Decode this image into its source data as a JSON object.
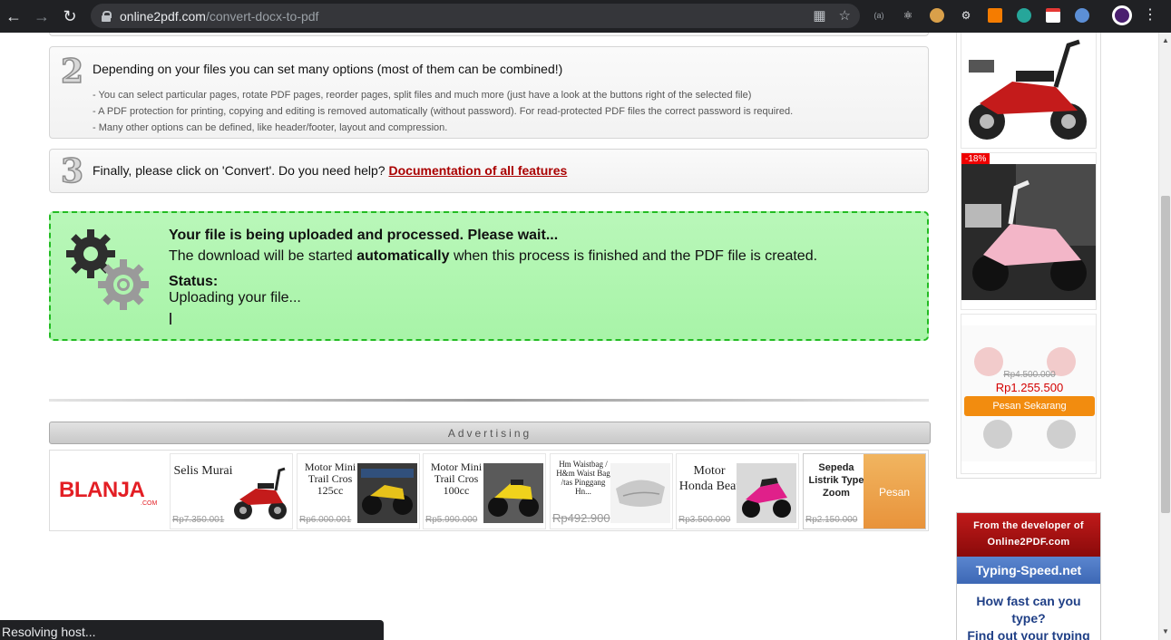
{
  "browser": {
    "url_host": "online2pdf.com",
    "url_path": "/convert-docx-to-pdf",
    "ext_a_label": "(a)"
  },
  "steps": {
    "step2": {
      "number": "2",
      "title": "Depending on your files you can set many options (most of them can be combined!)",
      "items": [
        "- You can select particular pages, rotate PDF pages, reorder pages, split files and much more (just have a look at the buttons right of the selected file)",
        "- A PDF protection for printing, copying and editing is removed automatically (without password). For read-protected PDF files the correct password is required.",
        "- Many other options can be defined, like header/footer, layout and compression."
      ]
    },
    "step3": {
      "number": "3",
      "text": "Finally, please click on 'Convert'. Do you need help?",
      "link": "Documentation of all features"
    }
  },
  "processing": {
    "title": "Your file is being uploaded and processed. Please wait...",
    "desc_pre": "The download will be started ",
    "desc_bold": "automatically",
    "desc_post": " when this process is finished and the PDF file is created.",
    "status_label": "Status:",
    "status_text": "Uploading your file..."
  },
  "advertising": {
    "label": "Advertising",
    "brand": "BLANJA",
    "brand_suffix": ".COM",
    "cards": [
      {
        "title": "Selis Murai",
        "price": "Rp7.350.001"
      },
      {
        "title": "Motor Mini Trail Cros 125cc",
        "price": "Rp6.000.001"
      },
      {
        "title": "Motor Mini Trail Cros 100cc",
        "price": "Rp5.990.000"
      },
      {
        "title": "Hm Waistbag / H&m Waist Bag /tas Pinggang Hn...",
        "price": "Rp492.900"
      },
      {
        "title": "Motor Honda Beat",
        "price": "Rp3.500.000"
      },
      {
        "title": "Sepeda Listrik Type Zoom",
        "price": "Rp2.150.000",
        "overlay": "Pesan"
      }
    ]
  },
  "sidebar": {
    "discount": "-18%",
    "old_price": "Rp4.500.000",
    "new_price": "Rp1.255.500",
    "order_button": "Pesan Sekarang",
    "dev_line1": "From the developer of",
    "dev_line2": "Online2PDF.com",
    "dev_site": "Typing-Speed.net",
    "dev_q1": "How fast can you",
    "dev_q2": "type?",
    "dev_q3": "Find out your typing"
  },
  "status_bar": "Resolving host...",
  "colors": {
    "accent_red": "#a00000",
    "status_green": "#a8f4a8",
    "status_border": "#22bb22",
    "order_orange": "#f28c0f"
  }
}
